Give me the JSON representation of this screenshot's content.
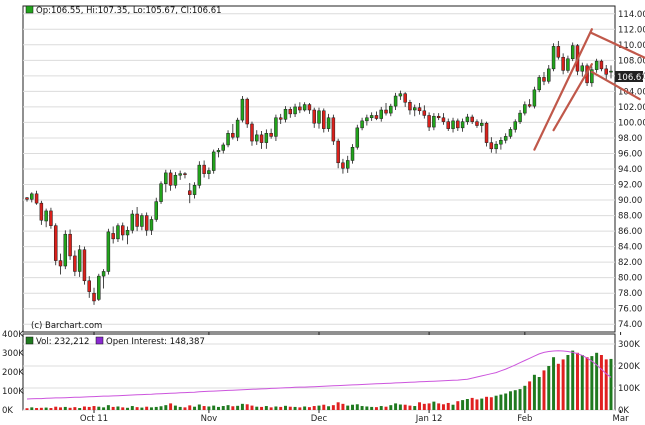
{
  "legend": {
    "ohlc_text": "Op:106.55, Hi:107.35, Lo:105.67, Cl:106.61",
    "last_price": "106.61",
    "copyright": "(c) Barchart.com",
    "vol_text": "Vol: 232,212",
    "oi_text": "Open Interest: 148,387"
  },
  "colors": {
    "up": "#22a41c",
    "down": "#d9211c",
    "vol_up": "#1f7a1f",
    "vol_down": "#e02020",
    "oi_line": "#cc55dd",
    "trendline": "#c0584a",
    "price_line": "#1a1a1a"
  },
  "chart_data": [
    {
      "type": "candlestick",
      "title": "",
      "ylim": [
        73,
        115
      ],
      "y_ticks": [
        "74.00",
        "76.00",
        "78.00",
        "80.00",
        "82.00",
        "84.00",
        "86.00",
        "88.00",
        "90.00",
        "92.00",
        "94.00",
        "96.00",
        "98.00",
        "100.00",
        "102.00",
        "104.00",
        "106.00",
        "108.00",
        "110.00",
        "112.00",
        "114.00"
      ],
      "x_ticks": [
        "Oct 11",
        "Nov",
        "Dec",
        "Jan 12",
        "Feb",
        "Mar"
      ],
      "x_tick_index": [
        14,
        38,
        61,
        84,
        104,
        124
      ],
      "annotations": [
        {
          "type": "trendline",
          "from": [
            106,
            96.5
          ],
          "to": [
            118,
            112
          ]
        },
        {
          "type": "trendline",
          "from": [
            110,
            99
          ],
          "to": [
            118,
            107.5
          ]
        },
        {
          "type": "trendline",
          "from": [
            118,
            111.5
          ],
          "to": [
            132,
            107.5
          ]
        },
        {
          "type": "trendline",
          "from": [
            118,
            106.5
          ],
          "to": [
            128,
            103
          ]
        }
      ],
      "candles": [
        [
          90.3,
          90.4,
          89.8,
          90.1
        ],
        [
          90.1,
          91.0,
          89.7,
          90.8
        ],
        [
          90.8,
          91.2,
          89.4,
          89.6
        ],
        [
          89.6,
          89.9,
          86.8,
          87.4
        ],
        [
          87.3,
          88.9,
          86.5,
          88.6
        ],
        [
          88.6,
          89.0,
          86.3,
          86.7
        ],
        [
          86.7,
          87.0,
          81.6,
          82.2
        ],
        [
          82.2,
          83.1,
          80.4,
          81.5
        ],
        [
          81.5,
          86.1,
          81.1,
          85.6
        ],
        [
          85.6,
          86.2,
          82.3,
          82.8
        ],
        [
          82.8,
          83.5,
          80.2,
          80.8
        ],
        [
          80.8,
          84.2,
          80.1,
          83.6
        ],
        [
          83.6,
          84.0,
          79.1,
          79.6
        ],
        [
          79.6,
          80.2,
          77.4,
          78.2
        ],
        [
          78.0,
          78.7,
          76.5,
          77.0
        ],
        [
          77.2,
          80.5,
          77.0,
          80.2
        ],
        [
          80.2,
          81.1,
          78.6,
          80.8
        ],
        [
          80.8,
          86.3,
          80.4,
          85.9
        ],
        [
          85.7,
          86.6,
          84.4,
          85.0
        ],
        [
          85.0,
          87.0,
          84.6,
          86.7
        ],
        [
          86.7,
          87.1,
          84.8,
          85.5
        ],
        [
          85.5,
          86.6,
          84.3,
          86.1
        ],
        [
          86.1,
          88.7,
          85.7,
          88.2
        ],
        [
          88.2,
          89.1,
          86.0,
          86.6
        ],
        [
          86.6,
          88.3,
          86.1,
          88.0
        ],
        [
          88.0,
          88.4,
          85.4,
          86.1
        ],
        [
          86.1,
          87.9,
          85.5,
          87.5
        ],
        [
          87.5,
          90.3,
          87.2,
          89.8
        ],
        [
          89.8,
          92.4,
          89.5,
          92.1
        ],
        [
          92.1,
          93.9,
          91.0,
          93.5
        ],
        [
          93.5,
          93.9,
          91.2,
          91.9
        ],
        [
          91.9,
          93.6,
          91.5,
          93.2
        ],
        [
          93.2,
          93.8,
          92.6,
          93.4
        ],
        [
          93.4,
          93.6,
          92.8,
          93.3
        ],
        [
          91.2,
          92.2,
          89.6,
          90.7
        ],
        [
          90.7,
          92.3,
          90.2,
          91.9
        ],
        [
          91.9,
          95.0,
          91.5,
          94.5
        ],
        [
          94.5,
          95.1,
          92.9,
          93.4
        ],
        [
          93.4,
          94.2,
          92.7,
          93.8
        ],
        [
          93.8,
          96.5,
          93.4,
          96.2
        ],
        [
          96.2,
          96.7,
          95.5,
          96.4
        ],
        [
          96.4,
          97.4,
          96.0,
          97.1
        ],
        [
          97.1,
          99.0,
          96.8,
          98.6
        ],
        [
          98.6,
          99.8,
          97.8,
          98.1
        ],
        [
          98.1,
          100.6,
          97.6,
          100.3
        ],
        [
          100.3,
          103.4,
          100.0,
          103.0
        ],
        [
          103.0,
          103.2,
          99.3,
          99.8
        ],
        [
          99.8,
          100.1,
          97.0,
          97.6
        ],
        [
          97.6,
          99.0,
          97.1,
          98.4
        ],
        [
          98.4,
          98.9,
          96.6,
          97.4
        ],
        [
          97.4,
          99.1,
          96.6,
          98.6
        ],
        [
          98.6,
          99.2,
          97.9,
          98.2
        ],
        [
          98.2,
          101.0,
          97.6,
          100.6
        ],
        [
          100.6,
          101.1,
          99.8,
          100.4
        ],
        [
          100.4,
          102.1,
          100.0,
          101.7
        ],
        [
          101.7,
          102.0,
          100.6,
          101.1
        ],
        [
          101.1,
          102.4,
          100.7,
          102.0
        ],
        [
          102.0,
          102.6,
          101.2,
          101.6
        ],
        [
          101.6,
          102.6,
          101.4,
          102.3
        ],
        [
          102.3,
          102.5,
          101.1,
          101.6
        ],
        [
          101.6,
          101.9,
          99.3,
          99.9
        ],
        [
          99.9,
          101.9,
          99.2,
          101.5
        ],
        [
          101.5,
          101.8,
          98.7,
          99.2
        ],
        [
          99.2,
          101.1,
          98.8,
          100.6
        ],
        [
          100.6,
          101.0,
          97.1,
          97.6
        ],
        [
          97.6,
          97.9,
          94.1,
          94.8
        ],
        [
          94.8,
          95.3,
          93.4,
          94.1
        ],
        [
          94.1,
          95.7,
          93.5,
          95.1
        ],
        [
          95.1,
          97.2,
          94.7,
          96.8
        ],
        [
          96.8,
          99.7,
          96.5,
          99.3
        ],
        [
          99.3,
          100.6,
          99.0,
          100.2
        ],
        [
          100.2,
          101.0,
          99.6,
          100.6
        ],
        [
          100.6,
          101.3,
          100.2,
          100.9
        ],
        [
          100.9,
          101.4,
          100.3,
          100.5
        ],
        [
          100.5,
          102.0,
          100.1,
          101.6
        ],
        [
          101.6,
          102.5,
          100.9,
          101.2
        ],
        [
          101.2,
          102.4,
          100.8,
          102.1
        ],
        [
          102.1,
          103.8,
          101.6,
          103.4
        ],
        [
          103.4,
          104.1,
          102.9,
          103.7
        ],
        [
          103.7,
          103.9,
          102.0,
          102.6
        ],
        [
          102.6,
          102.9,
          101.0,
          101.6
        ],
        [
          101.6,
          102.3,
          100.8,
          101.9
        ],
        [
          101.9,
          102.5,
          101.0,
          101.5
        ],
        [
          101.5,
          102.2,
          100.5,
          100.9
        ],
        [
          100.9,
          101.3,
          98.9,
          99.4
        ],
        [
          99.4,
          101.2,
          99.0,
          100.8
        ],
        [
          100.8,
          101.2,
          100.3,
          100.6
        ],
        [
          100.6,
          101.2,
          99.7,
          100.1
        ],
        [
          100.1,
          100.5,
          98.9,
          99.2
        ],
        [
          99.2,
          100.6,
          98.7,
          100.2
        ],
        [
          100.2,
          100.5,
          98.9,
          99.3
        ],
        [
          99.3,
          100.5,
          98.8,
          100.1
        ],
        [
          100.1,
          101.1,
          99.7,
          100.7
        ],
        [
          100.7,
          101.0,
          99.8,
          100.1
        ],
        [
          100.1,
          100.4,
          99.3,
          99.6
        ],
        [
          99.6,
          100.4,
          98.7,
          99.9
        ],
        [
          99.9,
          100.1,
          96.9,
          97.4
        ],
        [
          97.4,
          98.1,
          96.1,
          96.6
        ],
        [
          96.6,
          97.6,
          96.0,
          97.2
        ],
        [
          97.2,
          98.1,
          96.5,
          97.7
        ],
        [
          97.7,
          98.6,
          97.3,
          98.2
        ],
        [
          98.2,
          99.4,
          97.9,
          99.1
        ],
        [
          99.1,
          100.4,
          98.7,
          100.1
        ],
        [
          100.1,
          101.6,
          99.8,
          101.2
        ],
        [
          101.2,
          102.7,
          100.9,
          102.3
        ],
        [
          102.3,
          103.0,
          101.9,
          102.1
        ],
        [
          102.1,
          104.6,
          101.8,
          104.2
        ],
        [
          104.2,
          106.1,
          103.9,
          105.8
        ],
        [
          105.8,
          106.5,
          104.8,
          105.3
        ],
        [
          105.3,
          107.4,
          105.0,
          106.9
        ],
        [
          106.9,
          110.2,
          106.6,
          109.8
        ],
        [
          109.8,
          110.5,
          108.1,
          108.4
        ],
        [
          108.4,
          108.9,
          106.2,
          106.7
        ],
        [
          106.7,
          108.6,
          106.4,
          108.2
        ],
        [
          108.2,
          110.3,
          107.9,
          109.9
        ],
        [
          109.9,
          110.1,
          106.1,
          106.6
        ],
        [
          106.6,
          107.7,
          105.9,
          107.3
        ],
        [
          107.3,
          107.6,
          104.7,
          105.1
        ],
        [
          105.1,
          107.2,
          104.6,
          106.8
        ],
        [
          106.8,
          108.2,
          106.4,
          107.9
        ],
        [
          107.9,
          108.1,
          106.6,
          106.9
        ],
        [
          106.9,
          107.4,
          105.5,
          106.2
        ],
        [
          106.55,
          107.35,
          105.67,
          106.61
        ]
      ]
    },
    {
      "type": "bar",
      "title": "",
      "ylim": [
        0,
        300000
      ],
      "y_ticks_left": [
        "0K",
        "100K",
        "200K",
        "300K",
        "400K"
      ],
      "y_ticks_right": [
        "0K",
        "100K",
        "200K",
        "300K"
      ],
      "series": [
        {
          "name": "Vol",
          "values": [
            8000,
            12000,
            9000,
            10000,
            11000,
            9000,
            15000,
            12000,
            14000,
            10000,
            13000,
            9000,
            16000,
            14000,
            18000,
            15000,
            12000,
            22000,
            14000,
            16000,
            12000,
            10000,
            18000,
            13000,
            11000,
            15000,
            12000,
            14000,
            17000,
            22000,
            30000,
            20000,
            14000,
            12000,
            21000,
            15000,
            25000,
            18000,
            16000,
            20000,
            14000,
            18000,
            22000,
            17000,
            19000,
            28000,
            26000,
            20000,
            15000,
            14000,
            18000,
            12000,
            16000,
            14000,
            19000,
            15000,
            14000,
            12000,
            16000,
            13000,
            18000,
            20000,
            24000,
            17000,
            22000,
            35000,
            28000,
            20000,
            24000,
            26000,
            18000,
            16000,
            14000,
            13000,
            18000,
            15000,
            22000,
            30000,
            25000,
            24000,
            20000,
            18000,
            35000,
            28000,
            30000,
            38000,
            30000,
            26000,
            32000,
            24000,
            40000,
            45000,
            50000,
            55000,
            48000,
            52000,
            60000,
            58000,
            65000,
            70000,
            75000,
            85000,
            90000,
            95000,
            110000,
            130000,
            160000,
            150000,
            180000,
            200000,
            240000,
            210000,
            230000,
            250000,
            270000,
            260000,
            250000,
            240000,
            245000,
            260000,
            250000,
            230000,
            232212
          ]
        },
        {
          "name": "Open Interest",
          "values": [
            50000,
            51000,
            52000,
            52000,
            53000,
            54000,
            55000,
            55000,
            56000,
            57000,
            58000,
            58000,
            59000,
            60000,
            61000,
            62000,
            63000,
            63000,
            64000,
            65000,
            66000,
            67000,
            68000,
            69000,
            70000,
            71000,
            72000,
            73000,
            74000,
            75000,
            76000,
            77000,
            78000,
            79000,
            80000,
            81000,
            83000,
            84000,
            85000,
            86000,
            87000,
            88000,
            89000,
            90000,
            91000,
            92000,
            93000,
            94000,
            95000,
            96000,
            97000,
            98000,
            99000,
            100000,
            101000,
            102000,
            103000,
            104000,
            104000,
            105000,
            106000,
            107000,
            108000,
            109000,
            110000,
            111000,
            112000,
            113000,
            114000,
            115000,
            116000,
            117000,
            118000,
            119000,
            120000,
            121000,
            122000,
            123000,
            124000,
            125000,
            126000,
            127000,
            128000,
            129000,
            130000,
            131000,
            132000,
            133000,
            134000,
            135000,
            136000,
            138000,
            140000,
            145000,
            150000,
            155000,
            160000,
            165000,
            170000,
            178000,
            186000,
            195000,
            205000,
            215000,
            225000,
            235000,
            245000,
            255000,
            262000,
            266000,
            268000,
            269000,
            268000,
            266000,
            262000,
            256000,
            248000,
            236000,
            222000,
            205000,
            185000,
            165000,
            148387
          ]
        }
      ]
    }
  ]
}
